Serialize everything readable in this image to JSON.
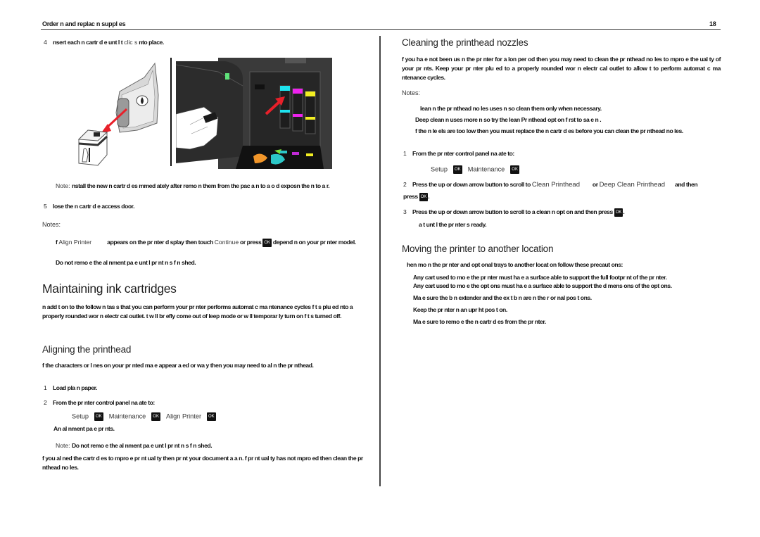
{
  "header": {
    "section_title": "Order n  and replac n  suppl es",
    "page_number": "18"
  },
  "left": {
    "step4": {
      "num": "4",
      "text": "nsert each  n  cartr d e unt l  t ",
      "text_light": "clic s",
      "text_end": "  nto place."
    },
    "note_install": {
      "label": "Note: ",
      "text": "nstall the new  n  cartr d es  mmed ately after remo  n  them from the pac a  n  to a o d exposn  the  n  to a r."
    },
    "step5": {
      "num": "5",
      "text": "lose the  n  cartr d e access door."
    },
    "notes_label": "Notes:",
    "notes": [
      {
        "pre": "f ",
        "light1": "Align Printer",
        "mid": "appears on the pr nter d splay  then touch ",
        "light2": "Continue",
        "mid2": " or press ",
        "ok": "OK",
        "end": "  depend n  on your pr nter model."
      },
      {
        "text": "Do not remo e the al  nment pa e unt l pr nt n   s f n shed."
      }
    ],
    "maintaining": {
      "title": "Maintaining ink cartridges",
      "body": "n add t on to the follow n   tas s that you can perform  your pr nter performs automat c ma ntenance cycles  f  t  s plu   ed  nto a properly   rounded  wor   n   electr cal outlet.  t w ll br efly come out of   leep mode or w ll temporar ly turn on  f  t  s turned off."
    },
    "aligning": {
      "title": "Aligning the printhead",
      "body": "f the characters or l nes on your pr nted  ma e appear  a    ed or wa  y  then you may need to al   n the pr nthead.",
      "step1": {
        "num": "1",
        "text": "Load pla n paper."
      },
      "step2": {
        "num": "2",
        "text": "From the pr nter control panel  na    ate to:"
      },
      "menu_path": [
        "Setup",
        "Maintenance",
        "Align Printer"
      ],
      "ok_label": "OK",
      "result": "An al   nment pa e pr nts.",
      "note_label": "Note: ",
      "note_text": "Do not remo e the al   nment pa e unt l pr nt n   s f n shed.",
      "closing": "f you al   ned the cartr d es to  mpro e pr nt   ual ty  then pr nt your document a  a n.  f pr nt   ual ty has not  mpro ed  then clean the pr nthead no   les."
    }
  },
  "right": {
    "cleaning": {
      "title": "Cleaning the printhead nozzles",
      "body": "f you ha e not been us n  the pr nter for a lon   per od  then you may need to clean the pr nthead no   les to  mpro e the   ual ty of your pr nts. Keep your pr nter plu   ed  to a properly   rounded  wor   n   electr cal outlet to allow  t to perform automat c ma ntenance cycles.",
      "notes_label": "Notes:",
      "notes": [
        "lean n   the pr nthead no   les uses  n    so clean them only when necessary.",
        "Deep clean n   uses more  n    so try the   lean Pr nthead opt on f rst to sa e  n  .",
        "f the  n   le els are too low  then you must replace the  n   cartr d es before you can clean the pr nthead no   les."
      ],
      "step1": {
        "num": "1",
        "text": "From the pr nter control panel  na    ate to:"
      },
      "menu_path": [
        "Setup",
        "Maintenance"
      ],
      "ok_label": "OK",
      "step2": {
        "num": "2",
        "text": "Press the up or down arrow button to scroll to ",
        "light1": "Clean Printhead",
        "mid": " or ",
        "light2": "Deep Clean Printhead",
        "end": " and then press "
      },
      "step3": {
        "num": "3",
        "text": "Press the up or down arrow button to scroll to a clean n   opt on  and then press "
      },
      "wait": "a t unt l the pr nter  s ready."
    },
    "moving": {
      "title": "Moving the printer to another location",
      "intro": "hen mo  n   the pr nter and opt onal trays to another locat on  follow these precaut ons:",
      "items": [
        "Any cart used to mo e the pr nter must ha e a surface able to support the full footpr nt of the pr nter.",
        "Any cart used to mo e the opt ons must ha e a surface able to support the d mens ons of the opt ons.",
        "Ma e sure the b n extender and the ex t b n are  n the r or    nal pos t ons.",
        "Keep the pr nter  n an upr   ht pos t on.",
        "Ma e sure to remo e the  n   cartr d es from the pr nter."
      ]
    }
  },
  "figure": {
    "alt_left": "ink cartridge being removed from package",
    "alt_right": "ink cartridges being inserted into printer"
  },
  "colors": {
    "cyan": "#1ee3ee",
    "magenta": "#ee22ee",
    "yellow": "#f2ee22",
    "arrow_red": "#e8202a"
  }
}
